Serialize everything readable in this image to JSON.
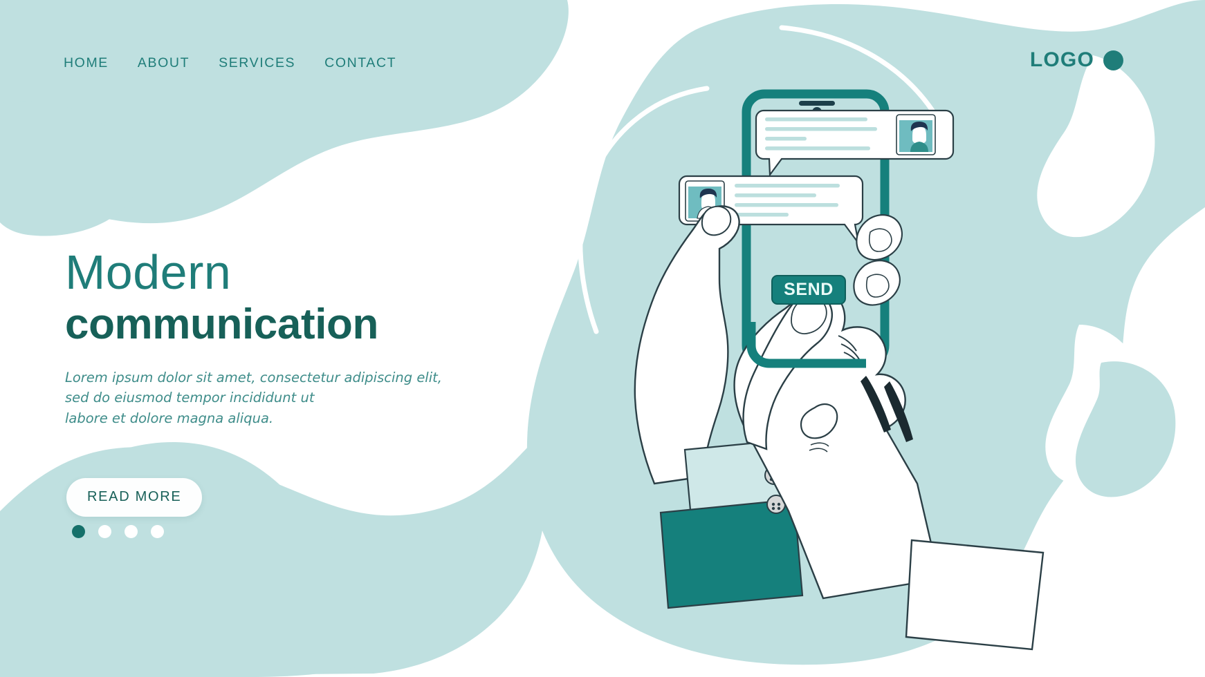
{
  "page": {
    "theme": {
      "blob_light": "#bfe0e0",
      "teal_mid": "#1f7d79",
      "teal_dark": "#176058",
      "teal_accent": "#15807c",
      "white": "#ffffff"
    }
  },
  "nav": {
    "items": [
      {
        "label": "HOME",
        "name": "nav-link-home"
      },
      {
        "label": "ABOUT",
        "name": "nav-link-about"
      },
      {
        "label": "SERVICES",
        "name": "nav-link-services"
      },
      {
        "label": "CONTACT",
        "name": "nav-link-contact"
      }
    ]
  },
  "logo": {
    "text": "LOGO",
    "mark": "filled-circle"
  },
  "hero": {
    "title_line1": "Modern",
    "title_line2": "communication",
    "paragraph_line1": "Lorem ipsum dolor sit amet, consectetur adipiscing elit,",
    "paragraph_line2": "sed do eiusmod tempor incididunt ut",
    "paragraph_line3": "labore et dolore magna aliqua.",
    "cta_label": "READ MORE",
    "carousel": {
      "total": 4,
      "active_index": 0
    }
  },
  "illustration": {
    "name": "hands-holding-phone-chat",
    "send_button_label": "SEND",
    "phone": {
      "name": "smartphone",
      "speaker": "earpiece-slot",
      "camera": "front-camera-dot"
    },
    "bubbles": [
      {
        "name": "chat-bubble-incoming",
        "avatar_side": "right",
        "avatar": "person-avatar-short-hair",
        "text_lines": 4,
        "tail": "bottom-left"
      },
      {
        "name": "chat-bubble-outgoing",
        "avatar_side": "left",
        "avatar": "person-avatar-back-view",
        "text_lines": 4,
        "tail": "bottom-right"
      }
    ],
    "sleeve": {
      "name": "shirt-cuff",
      "buttons": 2
    }
  }
}
